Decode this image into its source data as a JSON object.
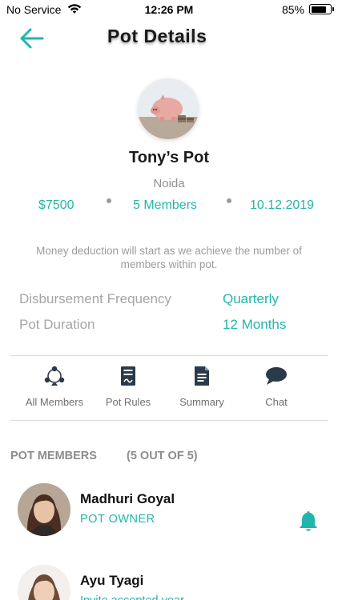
{
  "status_bar": {
    "carrier": "No Service",
    "time": "12:26 PM",
    "battery_percent": "85%",
    "battery_level": 0.85
  },
  "header": {
    "title": "Pot Details",
    "back_icon": "arrow-left-icon"
  },
  "pot": {
    "avatar_icon": "piggy-bank-image",
    "name": "Tony’s Pot",
    "location": "Noida",
    "amount": "$7500",
    "members": "5 Members",
    "date": "10.12.2019",
    "notice": "Money deduction will start as we achieve the number of members within pot."
  },
  "info": [
    {
      "label": "Disbursement Frequency",
      "value": "Quarterly"
    },
    {
      "label": "Pot Duration",
      "value": "12 Months"
    }
  ],
  "actions": [
    {
      "label": "All Members",
      "icon": "members-group-icon"
    },
    {
      "label": "Pot Rules",
      "icon": "rules-document-icon"
    },
    {
      "label": "Summary",
      "icon": "summary-document-icon"
    },
    {
      "label": "Chat",
      "icon": "chat-bubble-icon"
    }
  ],
  "members_section": {
    "title": "POT MEMBERS",
    "count": "(5 OUT OF 5)",
    "members": [
      {
        "name": "Madhuri Goyal",
        "role": "POT OWNER",
        "icon": "bell-icon"
      },
      {
        "name": "Ayu Tyagi",
        "role": "Invite accepted year"
      }
    ]
  },
  "colors": {
    "accent": "#22b5ae",
    "muted": "#9b9b9b"
  }
}
